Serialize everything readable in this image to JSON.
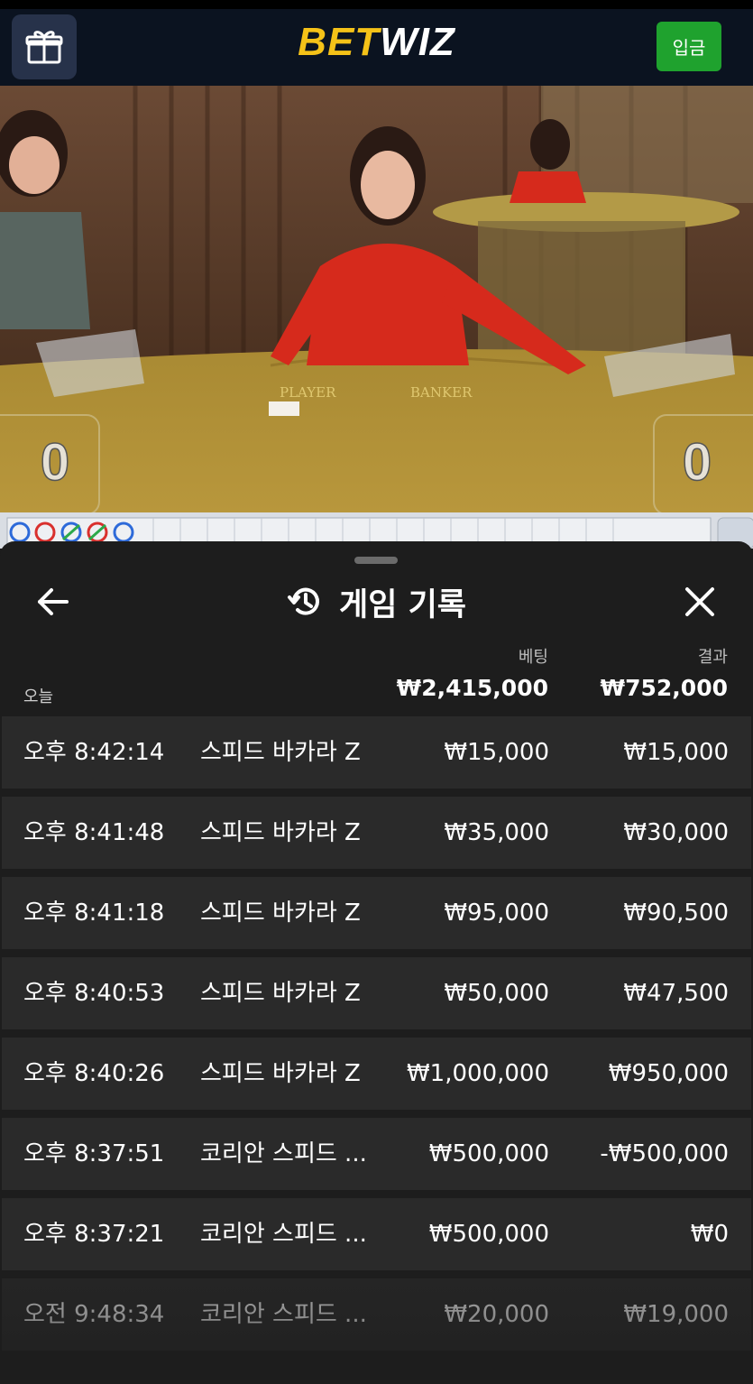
{
  "header": {
    "logo_part1": "BET",
    "logo_part2": "WIZ",
    "deposit_label": "입금",
    "gift_icon": "gift-icon"
  },
  "video": {
    "player_label": "PLAYER",
    "banker_label": "BANKER",
    "player_score": "0",
    "banker_score": "0"
  },
  "sheet": {
    "title": "게임 기록",
    "history_icon": "history-icon",
    "back_icon": "arrow-left-icon",
    "close_icon": "close-icon",
    "col_bet": "베팅",
    "col_result": "결과",
    "today_label": "오늘",
    "total_bet": "₩2,415,000",
    "total_result": "₩752,000"
  },
  "rows": [
    {
      "time": "오후 8:42:14",
      "game": "스피드 바카라 Z",
      "bet": "₩15,000",
      "result": "₩15,000"
    },
    {
      "time": "오후 8:41:48",
      "game": "스피드 바카라 Z",
      "bet": "₩35,000",
      "result": "₩30,000"
    },
    {
      "time": "오후 8:41:18",
      "game": "스피드 바카라 Z",
      "bet": "₩95,000",
      "result": "₩90,500"
    },
    {
      "time": "오후 8:40:53",
      "game": "스피드 바카라 Z",
      "bet": "₩50,000",
      "result": "₩47,500"
    },
    {
      "time": "오후 8:40:26",
      "game": "스피드 바카라 Z",
      "bet": "₩1,000,000",
      "result": "₩950,000"
    },
    {
      "time": "오후 8:37:51",
      "game": "코리안 스피드 ...",
      "bet": "₩500,000",
      "result": "-₩500,000"
    },
    {
      "time": "오후 8:37:21",
      "game": "코리안 스피드 ...",
      "bet": "₩500,000",
      "result": "₩0"
    },
    {
      "time": "오전 9:48:34",
      "game": "코리안 스피드 ...",
      "bet": "₩20,000",
      "result": "₩19,000"
    }
  ],
  "colors": {
    "header_bg": "#0b1320",
    "logo_yellow": "#f5c218",
    "deposit_green": "#1fa22e",
    "sheet_bg": "#1d1d1d",
    "row_bg": "#2a2a2a"
  }
}
